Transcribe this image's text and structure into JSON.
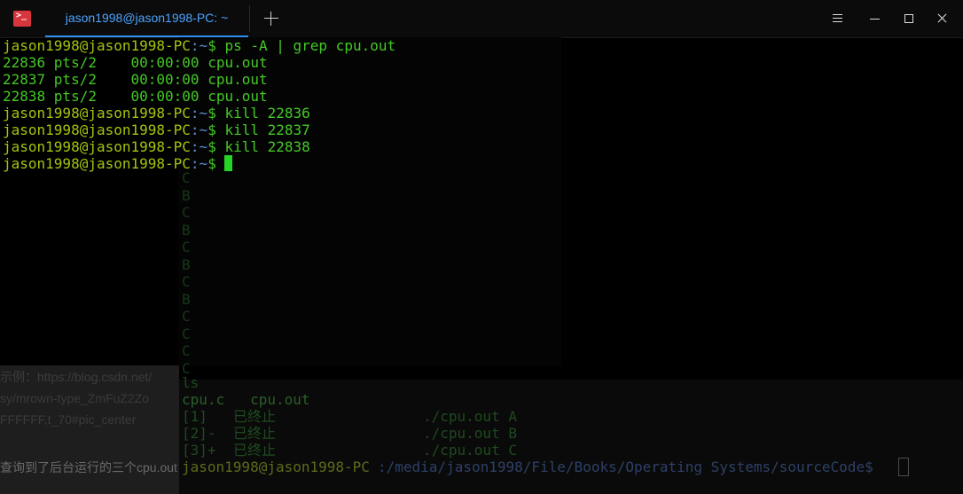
{
  "window": {
    "tab_title": "jason1998@jason1998-PC: ~",
    "app_icon_glyph": ">_"
  },
  "terminal": {
    "prompt_user": "jason1998@jason1998-PC",
    "prompt_path": ":~",
    "prompt_symbol": "$ ",
    "lines": [
      {
        "type": "prompt",
        "cmd": "ps -A | grep cpu.out"
      },
      {
        "type": "out",
        "text": "22836 pts/2    00:00:00 cpu.out"
      },
      {
        "type": "out",
        "text": "22837 pts/2    00:00:00 cpu.out"
      },
      {
        "type": "out",
        "text": "22838 pts/2    00:00:00 cpu.out"
      },
      {
        "type": "prompt",
        "cmd": "kill 22836"
      },
      {
        "type": "prompt",
        "cmd": "kill 22837"
      },
      {
        "type": "prompt",
        "cmd": "kill 22838"
      },
      {
        "type": "prompt",
        "cmd": ""
      }
    ]
  },
  "background_window": {
    "column_letters": [
      "C",
      "B",
      "C",
      "B",
      "C",
      "B",
      "C",
      "B",
      "C",
      "C",
      "C",
      "C"
    ],
    "ls_cmd": "ls",
    "ls_output": "cpu.c   cpu.out",
    "jobs": [
      {
        "id": "[1]",
        "state": "已终止",
        "cmd": "./cpu.out A"
      },
      {
        "id": "[2]-",
        "state": "已终止",
        "cmd": "./cpu.out B"
      },
      {
        "id": "[3]+",
        "state": "已终止",
        "cmd": "./cpu.out C"
      }
    ],
    "prompt_text": "jason1998@jason1998-PC",
    "prompt_path": ":/media/jason1998/File/Books/Operating Systems/sourceCode$",
    "doc_lines": [
      "示例：https://blog.csdn.net/",
      "sy/mrown-type_ZmFuZ2Zo",
      "FFFFFF,t_70#pic_center",
      "查询到了后台运行的三个cpu.out"
    ]
  }
}
